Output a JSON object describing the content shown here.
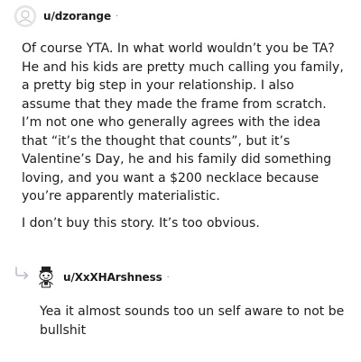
{
  "comment": {
    "username": "u/dzorange",
    "separator": "·",
    "avatar_icon": "default-avatar-icon",
    "paragraphs": [
      "Of course YTA. In what world wouldn’t you be TA? He and his kids are pretty much calling you family, a pretty big step in your relationship. I also assume that they made the frame from scratch. I’m not one who generally agrees with the idea that “it’s the thought that counts”, but it’s Valentine’s Day, he and his family did something loving, and you want a $200 necklace because you’re apparently materialistic.",
      "I don’t buy this story. It’s too obvious."
    ]
  },
  "reply": {
    "username": "u/XxXHArshness",
    "separator": "·",
    "avatar_icon": "snoo-avatar-icon",
    "reply_icon": "reply-arrow-icon",
    "text": "Yea it almost sounds too un self aware to not be bullshit"
  }
}
